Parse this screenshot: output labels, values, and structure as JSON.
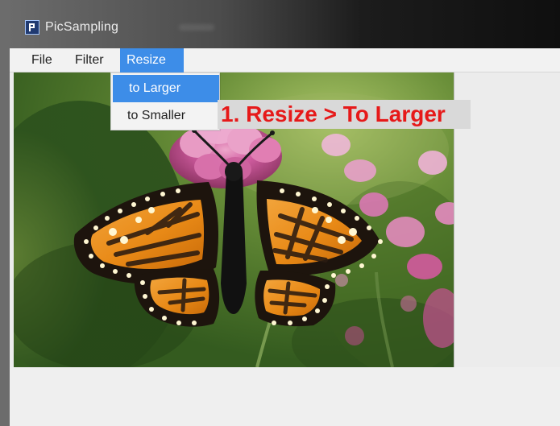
{
  "window": {
    "title": "PicSampling",
    "icon_name": "app-icon"
  },
  "menubar": {
    "file": "File",
    "filter": "Filter",
    "resize": "Resize"
  },
  "dropdown": {
    "items": [
      {
        "label": "to Larger",
        "selected": true
      },
      {
        "label": "to Smaller",
        "selected": false
      }
    ]
  },
  "annotation": {
    "text": "1. Resize > To Larger"
  },
  "colors": {
    "accent": "#3d8de8",
    "annotation_text": "#e61919",
    "annotation_bg": "#d9d9d9"
  },
  "canvas": {
    "image_name": "butterfly-photo"
  }
}
